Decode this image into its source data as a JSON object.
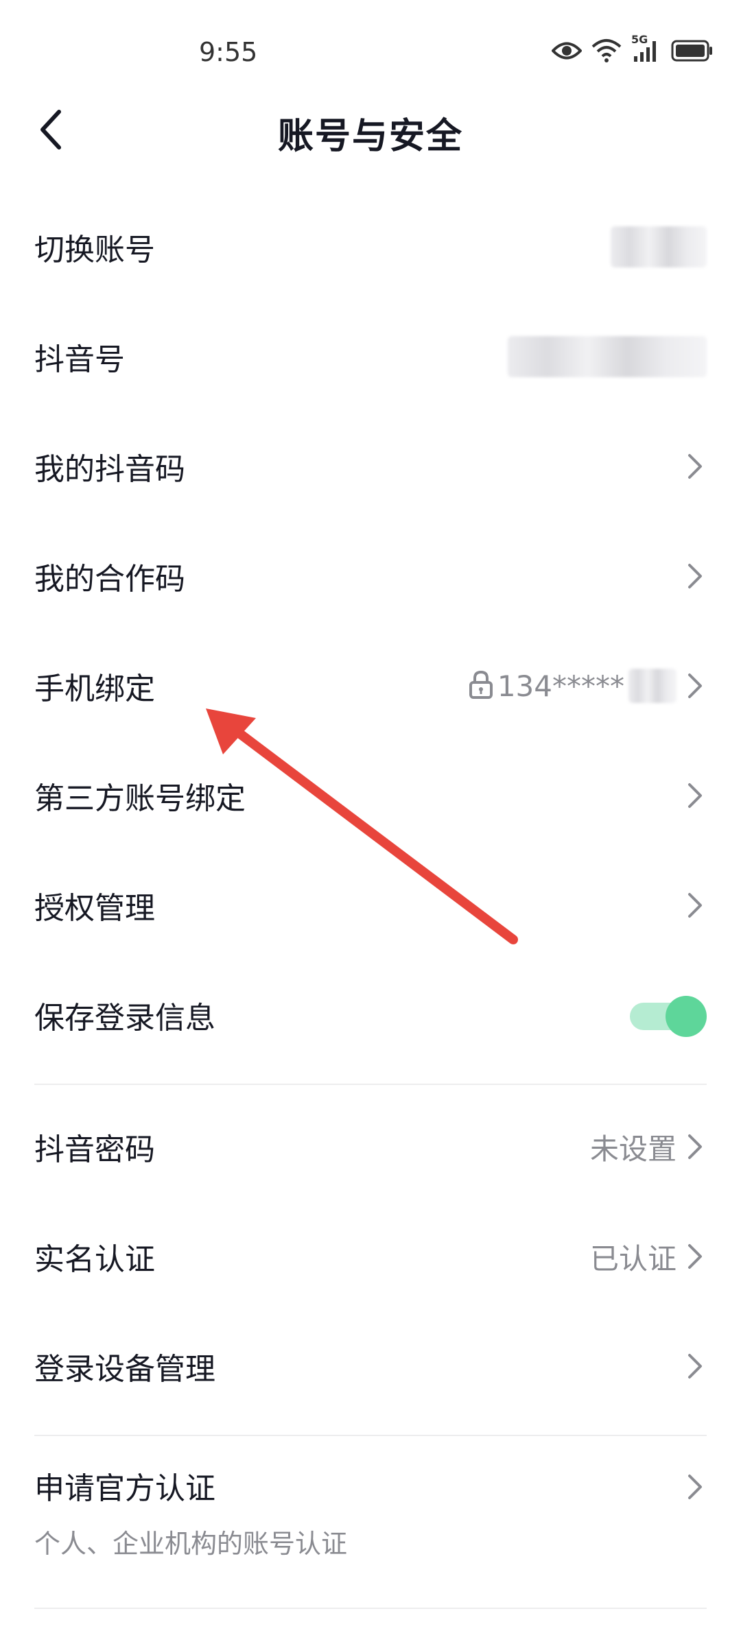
{
  "status_bar": {
    "time": "9:55",
    "icons": [
      "eye-icon",
      "wifi-icon",
      "5g-signal-icon",
      "battery-icon"
    ],
    "network_label": "5G"
  },
  "header": {
    "title": "账号与安全",
    "back_icon": "chevron-left-icon"
  },
  "items": [
    {
      "label": "切换账号",
      "value": "",
      "blurred": true,
      "chevron": false
    },
    {
      "label": "抖音号",
      "value": "",
      "blurred": true,
      "chevron": false
    },
    {
      "label": "我的抖音码",
      "value": "",
      "chevron": true
    },
    {
      "label": "我的合作码",
      "value": "",
      "chevron": true
    },
    {
      "label": "手机绑定",
      "value": "134*****",
      "icon": "lock-icon",
      "chevron": true
    },
    {
      "label": "第三方账号绑定",
      "value": "",
      "chevron": true
    },
    {
      "label": "授权管理",
      "value": "",
      "chevron": true
    },
    {
      "label": "保存登录信息",
      "toggle": true,
      "toggle_on": true
    }
  ],
  "items2": [
    {
      "label": "抖音密码",
      "value": "未设置",
      "chevron": true
    },
    {
      "label": "实名认证",
      "value": "已认证",
      "chevron": true
    },
    {
      "label": "登录设备管理",
      "value": "",
      "chevron": true
    }
  ],
  "items3": [
    {
      "label": "申请官方认证",
      "sublabel": "个人、企业机构的账号认证",
      "chevron": true
    }
  ],
  "colors": {
    "accent_toggle": "#5ed69a",
    "annotation_arrow": "#e8453c",
    "secondary_text": "#8a8b91"
  }
}
